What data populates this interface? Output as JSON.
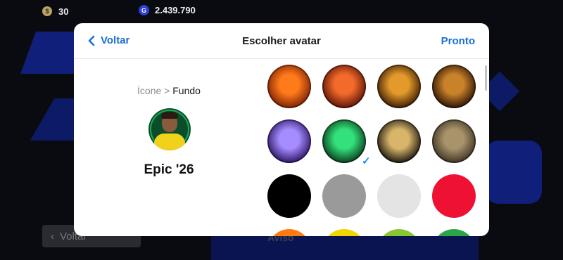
{
  "top_bar": {
    "coins": "30",
    "gp": "2.439.790"
  },
  "background": {
    "back_label": "Voltar",
    "aviso_label": "Aviso"
  },
  "modal": {
    "back_label": "Voltar",
    "title": "Escolher avatar",
    "done_label": "Pronto",
    "breadcrumb": {
      "first": "Ícone",
      "separator": ">",
      "current": "Fundo"
    },
    "selected_name": "Epic '26",
    "avatars": [
      {
        "name": "avatar-orange-flame",
        "colors": [
          "#ff7a1a",
          "#7a1f05"
        ]
      },
      {
        "name": "avatar-red-swirl",
        "colors": [
          "#f26b2a",
          "#5a1208"
        ]
      },
      {
        "name": "avatar-gold-spiral",
        "colors": [
          "#e39a2a",
          "#3a1a06"
        ]
      },
      {
        "name": "avatar-pes-logo-dark",
        "colors": [
          "#c9822a",
          "#2a1206"
        ]
      },
      {
        "name": "avatar-purple-lightning",
        "colors": [
          "#a58cff",
          "#2a1260"
        ]
      },
      {
        "name": "avatar-green-hexagon",
        "colors": [
          "#33e07a",
          "#0a3a1c"
        ],
        "selected": true
      },
      {
        "name": "avatar-pes-logo-black",
        "colors": [
          "#d8b56a",
          "#16130e"
        ]
      },
      {
        "name": "avatar-sand-texture",
        "colors": [
          "#a8946a",
          "#3d3224"
        ]
      },
      {
        "name": "avatar-black",
        "colors": [
          "#000000",
          "#000000"
        ]
      },
      {
        "name": "avatar-gray",
        "colors": [
          "#9a9a9a",
          "#9a9a9a"
        ]
      },
      {
        "name": "avatar-light-gray",
        "colors": [
          "#e4e4e4",
          "#e4e4e4"
        ]
      },
      {
        "name": "avatar-red",
        "colors": [
          "#ee1133",
          "#ee1133"
        ]
      },
      {
        "name": "avatar-orange",
        "colors": [
          "#ff7a10",
          "#ff7a10"
        ]
      },
      {
        "name": "avatar-yellow",
        "colors": [
          "#f2d400",
          "#f2d400"
        ]
      },
      {
        "name": "avatar-lime",
        "colors": [
          "#8ac633",
          "#8ac633"
        ]
      },
      {
        "name": "avatar-green",
        "colors": [
          "#2aa646",
          "#2aa646"
        ]
      }
    ],
    "accent": "#1a6fd6"
  }
}
